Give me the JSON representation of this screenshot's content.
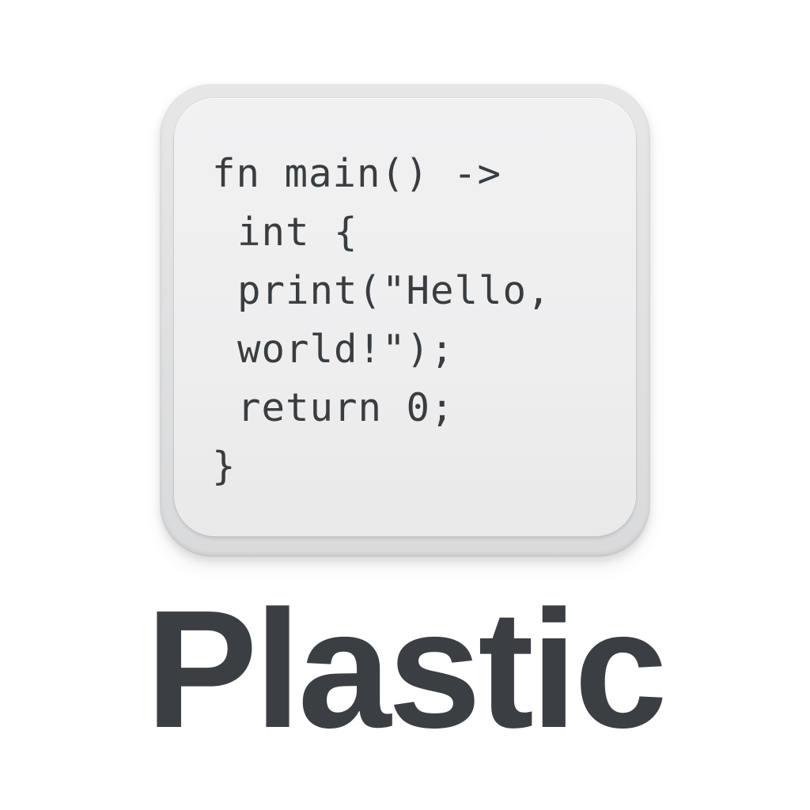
{
  "logo": {
    "code_lines": [
      "fn main() ->",
      "int {",
      "print(\"Hello,",
      "world!\");",
      "return 0;",
      "}"
    ],
    "brand_name": "Plastic"
  },
  "colors": {
    "background": "#ffffff",
    "tile_face": "#eeeeef",
    "tile_rim": "#d9dadb",
    "code_text": "#3a3d40",
    "brand_text": "#3b3f43"
  }
}
